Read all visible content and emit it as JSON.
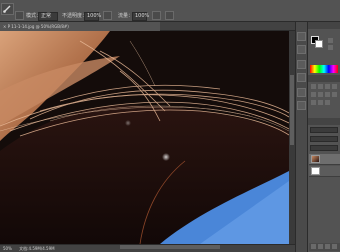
{
  "options_bar": {
    "mode_value": "正常",
    "opacity_label": "不透明度：",
    "opacity_value": "100%",
    "flow_label": "流量：",
    "flow_value": "100%"
  },
  "document_tab": {
    "title": "× P 11-1-14.jpg @ 50%(RGB/8#)"
  },
  "status_bar": {
    "zoom_text": "50%",
    "doc_info": "文档:4.59M/4.59M"
  },
  "colors": {
    "ui_dark": "#535353",
    "canvas_dark": "#140c0a",
    "hair_highlight": "#e8b896",
    "sky_blue": "#4a86d8"
  },
  "icons": [
    "brush-tool-icon",
    "brush-preset-icon",
    "pressure-icon",
    "airbrush-icon",
    "color-icon",
    "swatches-icon",
    "adjustments-icon",
    "layers-icon",
    "channels-icon"
  ]
}
